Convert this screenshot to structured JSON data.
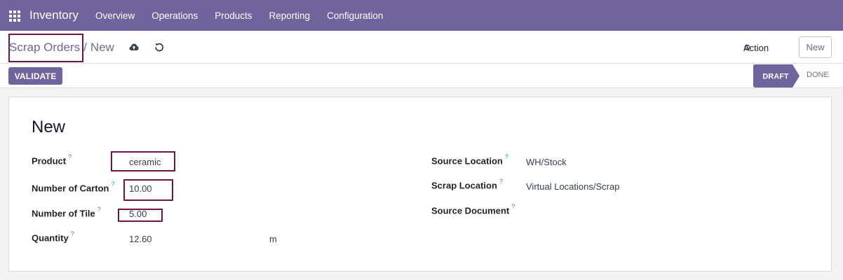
{
  "navbar": {
    "app_name": "Inventory",
    "menu": [
      "Overview",
      "Operations",
      "Products",
      "Reporting",
      "Configuration"
    ]
  },
  "breadcrumb": {
    "parent": "Scrap Orders",
    "separator": "/",
    "current": "New"
  },
  "control": {
    "action_label": "Action",
    "new_label": "New"
  },
  "statusbar": {
    "validate_label": "VALIDATE",
    "stages": [
      "DRAFT",
      "DONE"
    ],
    "active_stage": "DRAFT"
  },
  "form": {
    "title": "New",
    "left_fields": [
      {
        "label": "Product",
        "help": "?",
        "value": "ceramic"
      },
      {
        "label": "Number of Carton",
        "help": "?",
        "value": "10.00"
      },
      {
        "label": "Number of Tile",
        "help": "?",
        "value": "5.00"
      },
      {
        "label": "Quantity",
        "help": "?",
        "value": "12.60",
        "unit": "m"
      }
    ],
    "right_fields": [
      {
        "label": "Source Location",
        "help": "?",
        "value": "WH/Stock"
      },
      {
        "label": "Scrap Location",
        "help": "?",
        "value": "Virtual Locations/Scrap"
      },
      {
        "label": "Source Document",
        "help": "?",
        "value": ""
      }
    ]
  },
  "colors": {
    "brand": "#71639e",
    "highlight": "#6e1546",
    "help": "#1f8ec4"
  },
  "icons": [
    "apps-grid-icon",
    "cloud-upload-icon",
    "undo-icon",
    "gear-icon"
  ]
}
